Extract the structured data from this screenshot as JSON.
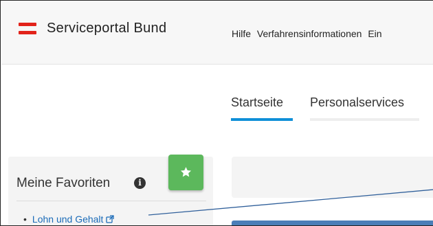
{
  "header": {
    "brand": "Serviceportal Bund",
    "logo_icon": "austria-flag-icon",
    "nav": [
      "Hilfe",
      "Verfahrensinformationen",
      "Ein"
    ]
  },
  "tabs": [
    {
      "label": "Startseite",
      "active": true
    },
    {
      "label": "Personalservices",
      "active": false
    }
  ],
  "favorites": {
    "title": "Meine Favoriten",
    "info_icon": "info-circle-icon",
    "star_button_icon": "star-icon",
    "items": [
      {
        "label": "Lohn und Gehalt",
        "icon": "external-link-icon"
      }
    ]
  },
  "colors": {
    "flag_red": "#e2231a",
    "tab_active": "#0f8fd8",
    "star_button": "#5cb85c",
    "link": "#1a6bb8",
    "annotation_line": "#2f5f9a"
  }
}
